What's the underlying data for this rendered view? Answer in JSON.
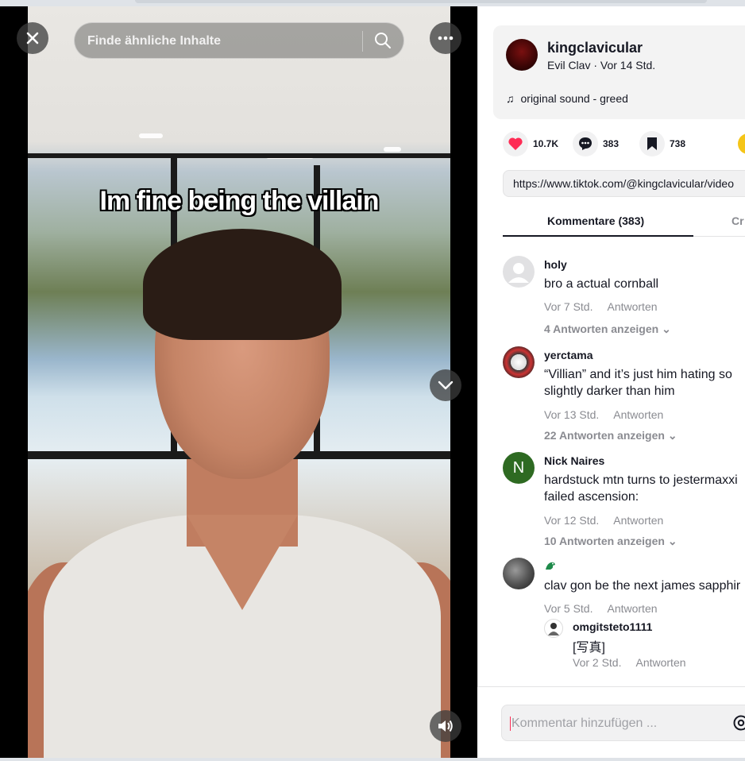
{
  "search": {
    "placeholder": "Finde ähnliche Inhalte"
  },
  "video": {
    "caption": "Im fine being the villain"
  },
  "author": {
    "username": "kingclavicular",
    "subtitle": "Evil Clav · Vor 14 Std.",
    "sound": "original sound - greed"
  },
  "actions": {
    "likes": "10.7K",
    "comments": "383",
    "saves": "738"
  },
  "url": "https://www.tiktok.com/@kingclavicular/video",
  "tabs": {
    "comments": "Kommentare (383)",
    "creator_videos": "Cr"
  },
  "comments": [
    {
      "name": "holy",
      "text": "bro a actual cornball",
      "time": "Vor 7 Std.",
      "reply": "Antworten",
      "more": "4 Antworten anzeigen"
    },
    {
      "name": "yerctama",
      "text_line1": "“Villian” and it’s just him hating so",
      "text_line2": "slightly darker than him",
      "time": "Vor 13 Std.",
      "reply": "Antworten",
      "more": "22 Antworten anzeigen"
    },
    {
      "name": "Nick Naires",
      "avatar_letter": "N",
      "text_line1": "hardstuck mtn turns to jestermaxxi",
      "text_line2": "failed ascension:",
      "time": "Vor 12 Std.",
      "reply": "Antworten",
      "more": "10 Antworten anzeigen"
    },
    {
      "name": "",
      "text": "clav gon be the next james sapphir",
      "time": "Vor 5 Std.",
      "reply": "Antworten"
    }
  ],
  "reply": {
    "name": "omgitsteto1111",
    "text": "[写真]",
    "time": "Vor 2 Std.",
    "reply": "Antworten"
  },
  "input": {
    "placeholder": "Kommentar hinzufügen ..."
  },
  "colors": {
    "like": "#fe2c55",
    "accent": "#fe2c55",
    "green_avatar": "#2e6a22",
    "coin": "#f5c518"
  }
}
